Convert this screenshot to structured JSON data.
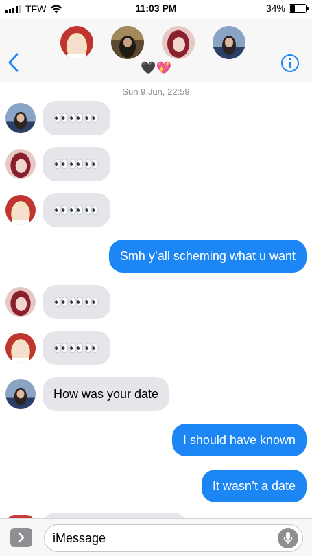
{
  "status_bar": {
    "carrier": "TFW",
    "time": "11:03 PM",
    "battery_percent": "34%",
    "battery_level": 0.34
  },
  "header": {
    "group_emoji": "🖤💖",
    "back_icon": "chevron-left-icon",
    "info_icon": "info-icon",
    "accent_color": "#1c86f5"
  },
  "conversation": {
    "timestamp": "Sun 9 Jun, 22:59",
    "messages": [
      {
        "direction": "in",
        "sender_avatar": "avatar-blue",
        "text": "👀👀👀"
      },
      {
        "direction": "in",
        "sender_avatar": "avatar-red",
        "text": "👀👀👀"
      },
      {
        "direction": "in",
        "sender_avatar": "avatar-blonde",
        "text": "👀👀👀"
      },
      {
        "direction": "out",
        "text": "Smh y’all scheming what u want"
      },
      {
        "direction": "in",
        "sender_avatar": "avatar-red",
        "text": "👀👀👀"
      },
      {
        "direction": "in",
        "sender_avatar": "avatar-blonde",
        "text": "👀👀👀"
      },
      {
        "direction": "in",
        "sender_avatar": "avatar-blue",
        "text": "How was your date"
      },
      {
        "direction": "out",
        "text": "I should have known"
      },
      {
        "direction": "out",
        "text": "It wasn’t a date"
      }
    ]
  },
  "input_bar": {
    "placeholder": "iMessage",
    "apps_icon": "chevron-right-icon",
    "mic_icon": "microphone-icon"
  },
  "colors": {
    "incoming_bubble": "#e5e5ea",
    "outgoing_bubble": "#1c86f5",
    "header_bg": "#f7f7f8"
  }
}
